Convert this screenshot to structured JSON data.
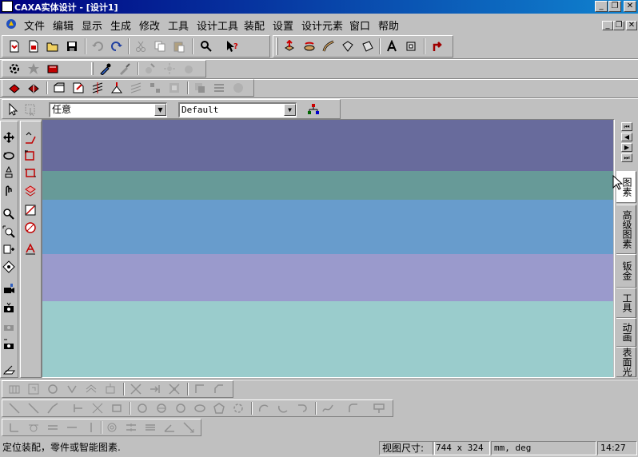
{
  "window": {
    "title": "CAXA实体设计 - [设计1]",
    "min_glyph": "_",
    "restore_glyph": "❐",
    "close_glyph": "✕"
  },
  "menu": {
    "items": [
      "文件",
      "编辑",
      "显示",
      "生成",
      "修改",
      "工具",
      "设计工具",
      "装配",
      "设置",
      "设计元素",
      "窗口",
      "帮助"
    ],
    "mdi_min": "_",
    "mdi_restore": "❐",
    "mdi_close": "✕"
  },
  "selection_bar": {
    "filter_value": "任意",
    "style_value": "Default",
    "dropdown_glyph": "▼"
  },
  "viewport": {
    "bands": [
      "#686b9c",
      "#679a98",
      "#689ccc",
      "#9a9acc",
      "#9acccc"
    ]
  },
  "design_element_tabs": {
    "nav_buttons": [
      "⏮",
      "◀",
      "▶",
      "⏭"
    ],
    "tabs": [
      "图素",
      "高级图素",
      "钣金",
      "工具",
      "动画",
      "表面光"
    ]
  },
  "status": {
    "message": "定位装配，零件或智能图素.",
    "view_size_label": "视图尺寸:",
    "view_size": "744 x  324",
    "units": "mm, deg",
    "time": "14:27"
  }
}
